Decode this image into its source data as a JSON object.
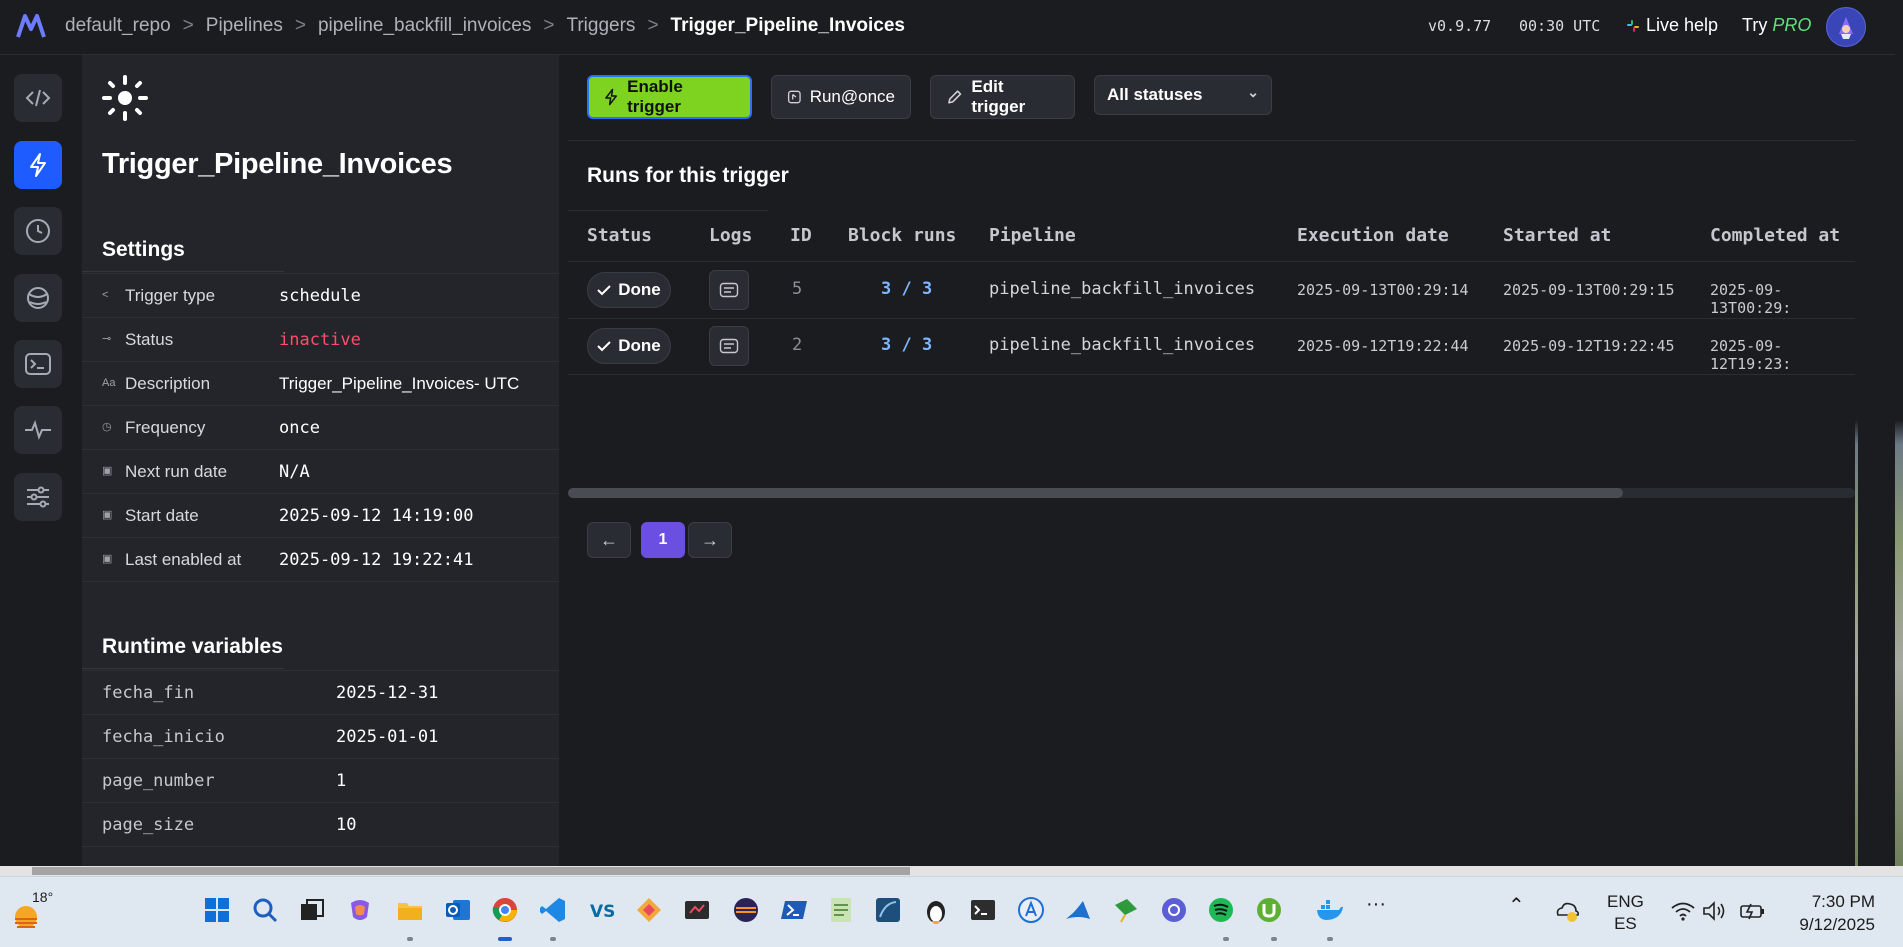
{
  "app": {
    "version": "v0.9.77",
    "clock": "00:30 UTC",
    "live_help": "Live help",
    "try_label": "Try",
    "pro_label": "PRO"
  },
  "breadcrumb": [
    "default_repo",
    "Pipelines",
    "pipeline_backfill_invoices",
    "Triggers",
    "Trigger_Pipeline_Invoices"
  ],
  "breadcrumb_separator": ">",
  "rail": {
    "items": [
      "code-icon",
      "bolt-icon",
      "clock-icon",
      "planet-icon",
      "terminal-icon",
      "pulse-icon",
      "sliders-icon"
    ],
    "active": "bolt-icon"
  },
  "trigger": {
    "title": "Trigger_Pipeline_Invoices",
    "settings_heading": "Settings",
    "settings": [
      {
        "label": "Trigger type",
        "value": "schedule",
        "icon": "share-icon",
        "mono": true
      },
      {
        "label": "Status",
        "value": "inactive",
        "icon": "toggle-icon",
        "mono": true,
        "status_color": "#ff4d6a"
      },
      {
        "label": "Description",
        "value": "Trigger_Pipeline_Invoices- UTC",
        "icon": "text-icon",
        "mono": false
      },
      {
        "label": "Frequency",
        "value": "once",
        "icon": "clock-icon",
        "mono": true
      },
      {
        "label": "Next run date",
        "value": "N/A",
        "icon": "calendar-icon",
        "mono": true
      },
      {
        "label": "Start date",
        "value": "2025-09-12 14:19:00",
        "icon": "calendar-icon",
        "mono": true
      },
      {
        "label": "Last enabled at",
        "value": "2025-09-12 19:22:41",
        "icon": "calendar-icon",
        "mono": true
      }
    ],
    "runtime_heading": "Runtime variables",
    "runtime_variables": [
      {
        "key": "fecha_fin",
        "value": "2025-12-31"
      },
      {
        "key": "fecha_inicio",
        "value": "2025-01-01"
      },
      {
        "key": "page_number",
        "value": "1"
      },
      {
        "key": "page_size",
        "value": "10"
      }
    ]
  },
  "toolbar": {
    "enable_label": "Enable trigger",
    "run_once_label": "Run@once",
    "edit_label": "Edit trigger",
    "status_filter": "All statuses",
    "accent_color": "#7ed321"
  },
  "runs": {
    "title": "Runs for this trigger",
    "columns": [
      "Status",
      "Logs",
      "ID",
      "Block runs",
      "Pipeline",
      "Execution date",
      "Started at",
      "Completed at"
    ],
    "rows": [
      {
        "status": "Done",
        "id": "5",
        "block_runs": "3 / 3",
        "pipeline": "pipeline_backfill_invoices",
        "execution_date": "2025-09-13T00:29:14",
        "started_at": "2025-09-13T00:29:15",
        "completed_at": "2025-09-13T00:29:"
      },
      {
        "status": "Done",
        "id": "2",
        "block_runs": "3 / 3",
        "pipeline": "pipeline_backfill_invoices",
        "execution_date": "2025-09-12T19:22:44",
        "started_at": "2025-09-12T19:22:45",
        "completed_at": "2025-09-12T19:23:"
      }
    ]
  },
  "pagination": {
    "current_page": "1",
    "prev_icon": "arrow-left-icon",
    "next_icon": "arrow-right-icon"
  },
  "taskbar": {
    "weather_temp": "18°",
    "lang_primary": "ENG",
    "lang_secondary": "ES",
    "time": "7:30 PM",
    "date": "9/12/2025"
  }
}
